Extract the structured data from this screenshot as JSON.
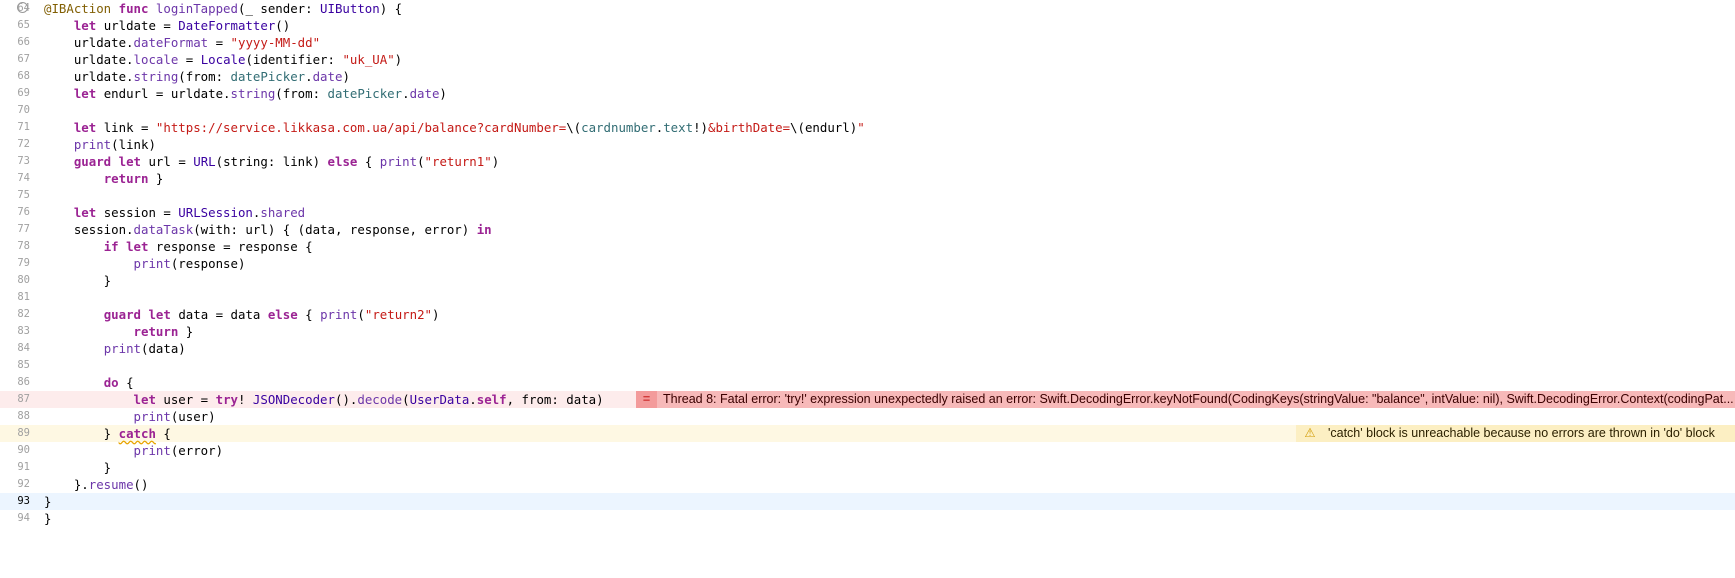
{
  "editor": {
    "lines": [
      {
        "n": "64"
      },
      {
        "n": "65"
      },
      {
        "n": "66"
      },
      {
        "n": "67"
      },
      {
        "n": "68"
      },
      {
        "n": "69"
      },
      {
        "n": "70"
      },
      {
        "n": "71"
      },
      {
        "n": "72"
      },
      {
        "n": "73"
      },
      {
        "n": "74"
      },
      {
        "n": "75"
      },
      {
        "n": "76"
      },
      {
        "n": "77"
      },
      {
        "n": "78"
      },
      {
        "n": "79"
      },
      {
        "n": "80"
      },
      {
        "n": "81"
      },
      {
        "n": "82"
      },
      {
        "n": "83"
      },
      {
        "n": "84"
      },
      {
        "n": "85"
      },
      {
        "n": "86"
      },
      {
        "n": "87"
      },
      {
        "n": "88"
      },
      {
        "n": "89"
      },
      {
        "n": "90"
      },
      {
        "n": "91"
      },
      {
        "n": "92"
      },
      {
        "n": "93"
      },
      {
        "n": "94"
      }
    ],
    "current_line": "93",
    "error": {
      "line": "86",
      "icon": "error-icon",
      "icon_glyph": "=",
      "message": "Thread 8: Fatal error: 'try!' expression unexpectedly raised an error: Swift.DecodingError.keyNotFound(CodingKeys(stringValue: \"balance\", intValue: nil), Swift.DecodingError.Context(codingPat..."
    },
    "warning": {
      "line": "88",
      "icon": "warning-icon",
      "icon_glyph": "⚠",
      "message": "'catch' block is unreachable because no errors are thrown in 'do' block"
    },
    "code": {
      "l64": [
        "@IBAction",
        " ",
        "func",
        " ",
        "loginTapped",
        "(_ sender: ",
        "UIButton",
        ") {"
      ],
      "l65": [
        "    ",
        "let",
        " urldate = ",
        "DateFormatter",
        "()"
      ],
      "l66": [
        "    urldate.",
        "dateFormat",
        " = ",
        "\"yyyy-MM-dd\""
      ],
      "l67": [
        "    urldate.",
        "locale",
        " = ",
        "Locale",
        "(identifier: ",
        "\"uk_UA\"",
        ")"
      ],
      "l68": [
        "    urldate.",
        "string",
        "(from: ",
        "datePicker",
        ".",
        "date",
        ")"
      ],
      "l69": [
        "    ",
        "let",
        " endurl = urldate.",
        "string",
        "(from: ",
        "datePicker",
        ".",
        "date",
        ")"
      ],
      "l71": [
        "    ",
        "let",
        " link = ",
        "\"https://service.likkasa.com.ua/api/balance?cardNumber=",
        "\\(",
        "cardnumber",
        ".",
        "text",
        "!)",
        "&birthDate=",
        "\\(endurl)",
        "\""
      ],
      "l72": [
        "    ",
        "print",
        "(link)"
      ],
      "l73": [
        "    ",
        "guard",
        " ",
        "let",
        " url = ",
        "URL",
        "(string: link) ",
        "else",
        " { ",
        "print",
        "(",
        "\"return1\"",
        ")"
      ],
      "l74": [
        "        ",
        "return",
        " }"
      ],
      "l76": [
        "    ",
        "let",
        " session = ",
        "URLSession",
        ".",
        "shared"
      ],
      "l77": [
        "    session.",
        "dataTask",
        "(with: url) { (data, response, error) ",
        "in"
      ],
      "l78": [
        "        ",
        "if",
        " ",
        "let",
        " response = response {"
      ],
      "l79": [
        "            ",
        "print",
        "(response)"
      ],
      "l80": [
        "        }"
      ],
      "l82": [
        "        ",
        "guard",
        " ",
        "let",
        " data = data ",
        "else",
        " { ",
        "print",
        "(",
        "\"return2\"",
        ")"
      ],
      "l83": [
        "            ",
        "return",
        " }"
      ],
      "l84": [
        "        ",
        "print",
        "(data)"
      ],
      "l86": [
        "        ",
        "do",
        " {"
      ],
      "l87": [
        "            ",
        "let",
        " user = ",
        "try",
        "! ",
        "JSONDecoder",
        "().",
        "decode",
        "(",
        "UserData",
        ".",
        "self",
        ", from: data)"
      ],
      "l88": [
        "            ",
        "print",
        "(user)"
      ],
      "l89": [
        "        } ",
        "catch",
        " {"
      ],
      "l90": [
        "            ",
        "print",
        "(error)"
      ],
      "l91": [
        "        }"
      ],
      "l92": [
        "    }.",
        "resume",
        "()"
      ],
      "l93": [
        "}"
      ],
      "l94": [
        "}"
      ]
    }
  }
}
